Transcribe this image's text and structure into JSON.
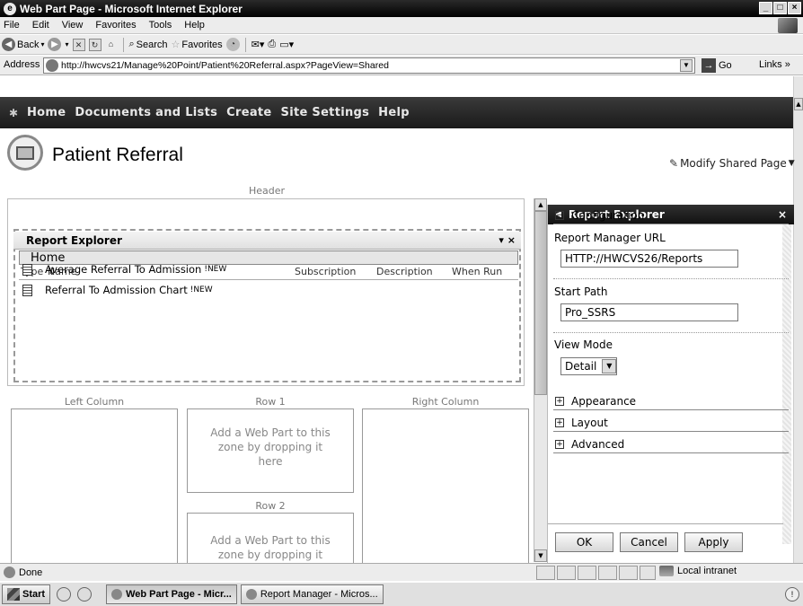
{
  "window": {
    "title": "Web Part Page - Microsoft Internet Explorer",
    "controls": [
      "_",
      "□",
      "×"
    ]
  },
  "menu": [
    "File",
    "Edit",
    "View",
    "Favorites",
    "Tools",
    "Help"
  ],
  "toolbar": {
    "back": "Back",
    "search": "Search",
    "favorites": "Favorites"
  },
  "address": {
    "label": "Address",
    "url": "http://hwcvs21/Manage%20Point/Patient%20Referral.aspx?PageView=Shared",
    "go": "Go",
    "links": "Links"
  },
  "nav": {
    "items": [
      "Home",
      "Documents and Lists",
      "Create",
      "Site Settings",
      "Help"
    ]
  },
  "page": {
    "title": "Patient Referral",
    "modify_link": "Modify Shared Page"
  },
  "zones": {
    "header": "Header",
    "left": "Left Column",
    "row1": "Row 1",
    "row2": "Row 2",
    "right": "Right Column",
    "drop_message": "Add a Web Part to this zone by dropping it here",
    "drop_message_row2": "Add a Web Part to this zone by dropping it"
  },
  "webpart": {
    "title": "Report Explorer",
    "menu_glyph": "▾ ×",
    "breadcrumb": "Home",
    "columns": {
      "type": "Type",
      "name": "Name",
      "subscription": "Subscription",
      "description": "Description",
      "when_run": "When Run"
    },
    "sort_arrow": "↓",
    "rows": [
      {
        "name": "Average Referral To Admission",
        "badge": "!NEW"
      },
      {
        "name": "Referral To Admission Chart",
        "badge": "!NEW"
      }
    ]
  },
  "toolpane": {
    "title": "Report Explorer",
    "close": "×",
    "configuration": "Configuration",
    "report_manager_url_label": "Report Manager URL",
    "report_manager_url": "HTTP://HWCVS26/Reports",
    "start_path_label": "Start Path",
    "start_path": "Pro_SSRS",
    "view_mode_label": "View Mode",
    "view_mode": "Detail",
    "sections": [
      "Appearance",
      "Layout",
      "Advanced"
    ],
    "buttons": {
      "ok": "OK",
      "cancel": "Cancel",
      "apply": "Apply"
    }
  },
  "status": {
    "text": "Done",
    "zone": "Local intranet"
  },
  "taskbar": {
    "start": "Start",
    "tasks": [
      "Web Part Page - Micr...",
      "Report Manager - Micros..."
    ]
  }
}
